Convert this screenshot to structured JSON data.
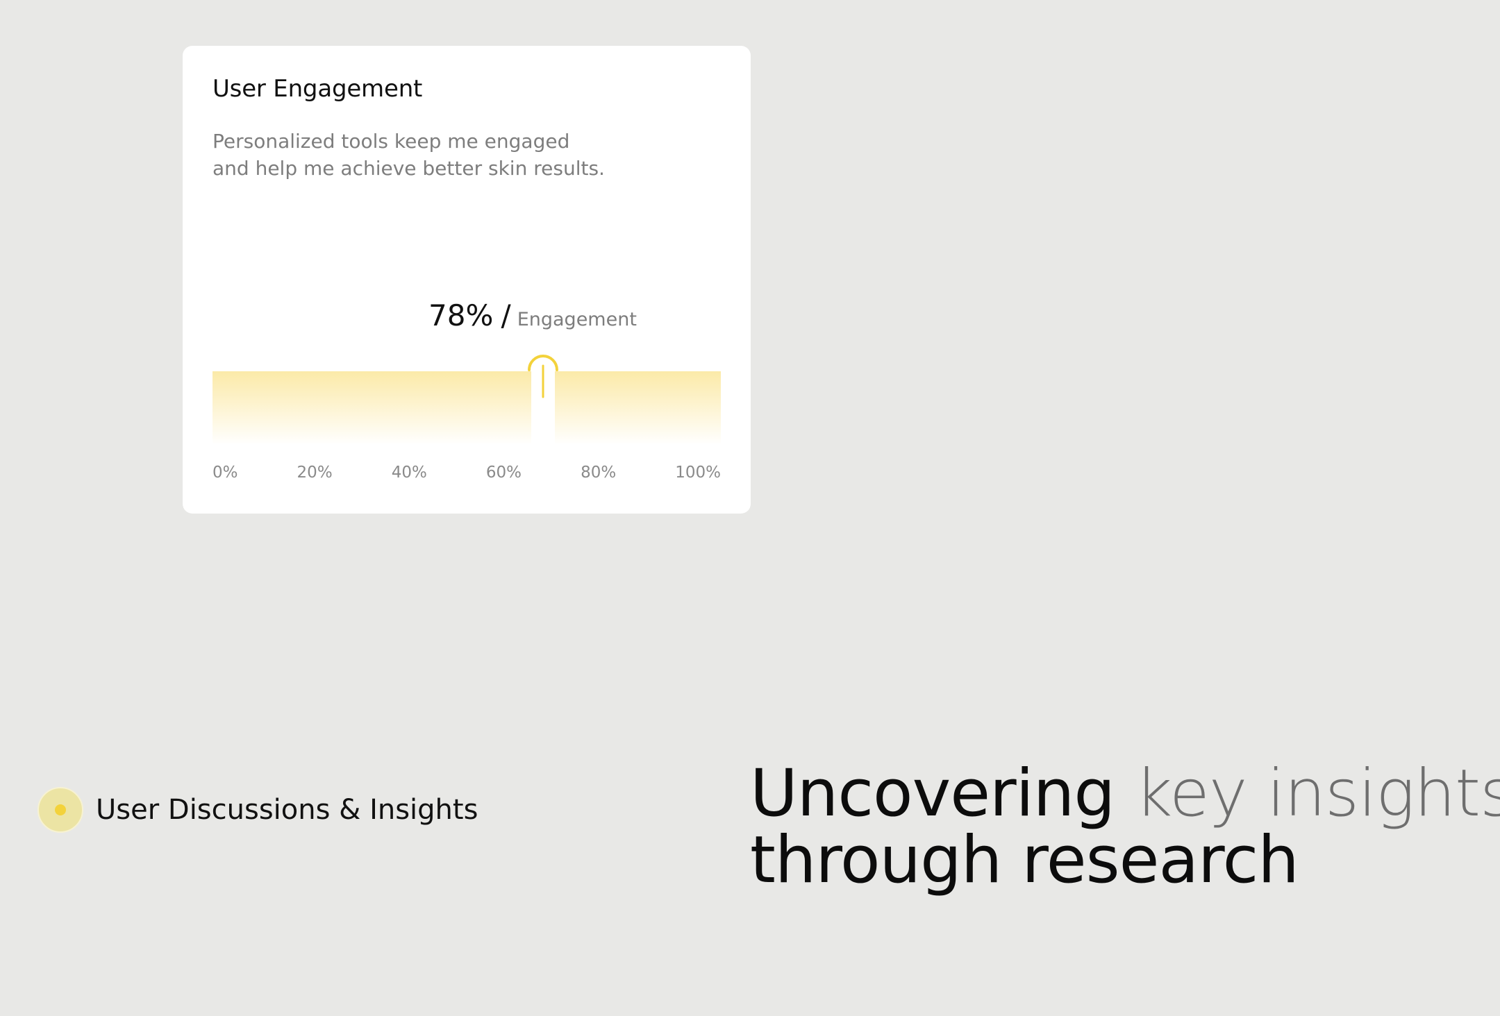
{
  "card": {
    "title": "User Engagement",
    "description_lines": [
      "Personalized tools keep me engaged",
      "and help me achieve better skin results."
    ],
    "readout": {
      "value": "78%",
      "separator": "/",
      "label": "Engagement"
    },
    "indicator": {
      "marker_position_percent": 65,
      "accent_color": "#f3d23b",
      "track_color": "#fbeaa8"
    },
    "scale_ticks": [
      "0%",
      "20%",
      "40%",
      "60%",
      "80%",
      "100%"
    ]
  },
  "section": {
    "icon": "dot-icon",
    "label": "User Discussions & Insights"
  },
  "headline": {
    "word_1": "Uncovering",
    "word_2": "key insights",
    "line_2": "through research"
  }
}
